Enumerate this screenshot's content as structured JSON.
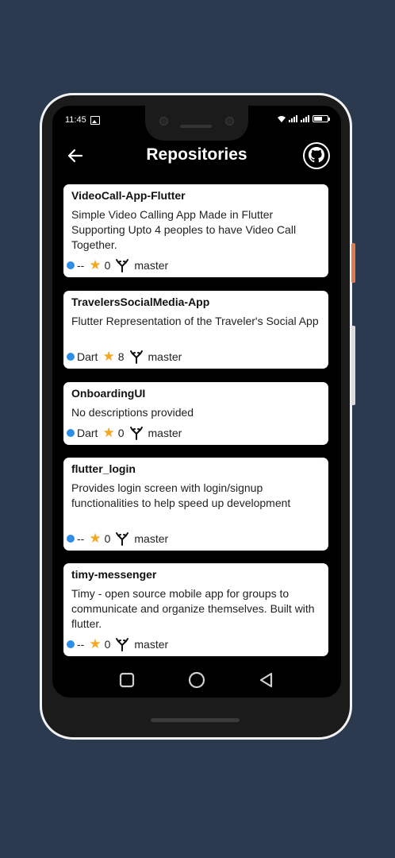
{
  "status_bar": {
    "time": "11:45"
  },
  "app_bar": {
    "title": "Repositories"
  },
  "colors": {
    "language_dot": "#2e8ee6",
    "star": "#f5a623",
    "background": "#2c3a4f"
  },
  "repos": [
    {
      "name": "VideoCall-App-Flutter",
      "description": "Simple Video Calling App Made in Flutter Supporting Upto 4 peoples to have Video Call Together.",
      "language": "--",
      "stars": "0",
      "branch": "master"
    },
    {
      "name": "TravelersSocialMedia-App",
      "description": "Flutter Representation of the Traveler's Social App",
      "language": "Dart",
      "stars": "8",
      "branch": "master"
    },
    {
      "name": "OnboardingUI",
      "description": "No descriptions provided",
      "language": "Dart",
      "stars": "0",
      "branch": "master"
    },
    {
      "name": "flutter_login",
      "description": "Provides login screen with login/signup functionalities to help speed up development",
      "language": "--",
      "stars": "0",
      "branch": "master"
    },
    {
      "name": "timy-messenger",
      "description": "Timy - open source mobile app for groups to communicate and organize themselves. Built with flutter.",
      "language": "--",
      "stars": "0",
      "branch": "master"
    }
  ],
  "icons": [
    "back-arrow-icon",
    "github-icon",
    "star-icon",
    "branch-icon",
    "recents-square-icon",
    "home-circle-icon",
    "back-triangle-icon"
  ]
}
